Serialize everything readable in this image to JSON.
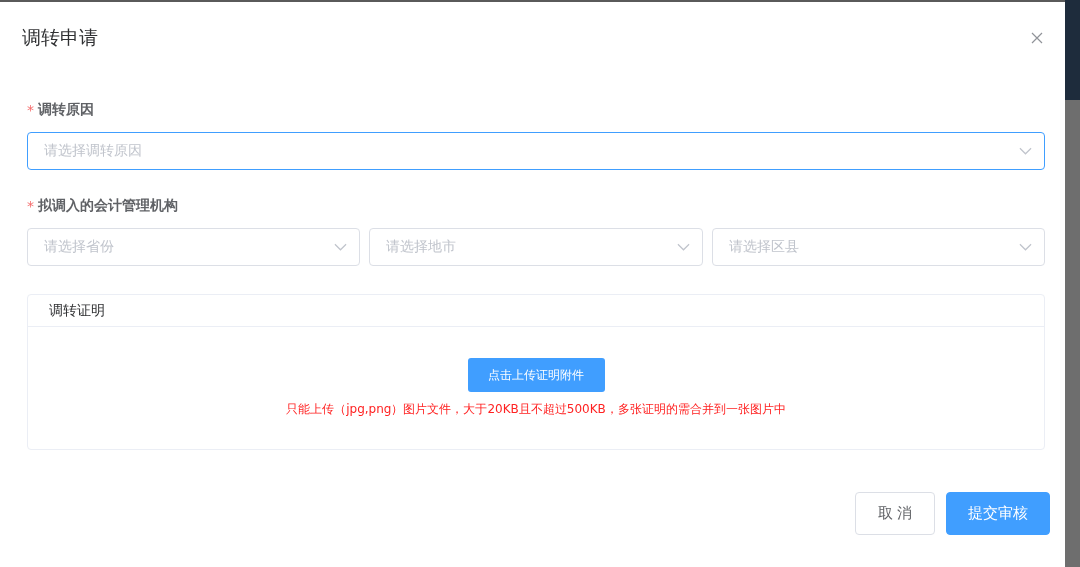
{
  "dialog": {
    "title": "调转申请"
  },
  "fields": [
    {
      "label": "调转原因",
      "required_mark": "*",
      "selects": [
        {
          "placeholder": "请选择调转原因",
          "focused": true
        }
      ]
    },
    {
      "label": "拟调入的会计管理机构",
      "required_mark": "*",
      "selects": [
        {
          "placeholder": "请选择省份",
          "focused": false
        },
        {
          "placeholder": "请选择地市",
          "focused": false
        },
        {
          "placeholder": "请选择区县",
          "focused": false
        }
      ]
    }
  ],
  "proof": {
    "title": "调转证明",
    "upload_button": "点击上传证明附件",
    "hint": "只能上传（jpg,png）图片文件，大于20KB且不超过500KB，多张证明的需合并到一张图片中"
  },
  "buttons": [
    {
      "label": "取 消",
      "kind": "secondary"
    },
    {
      "label": "提交审核",
      "kind": "primary"
    }
  ]
}
